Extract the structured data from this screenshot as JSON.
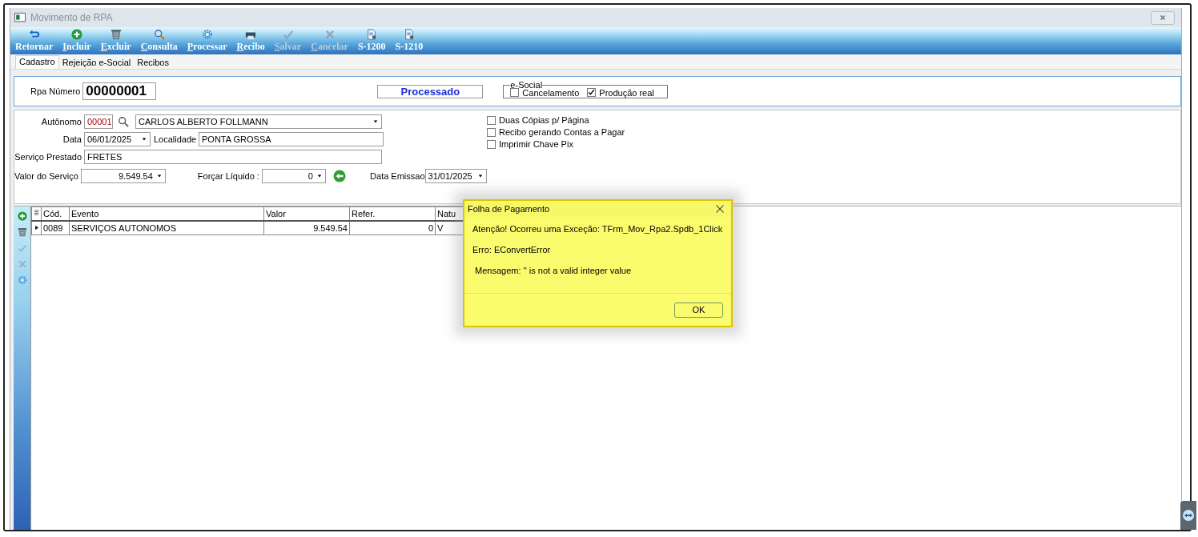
{
  "window": {
    "title": "Movimento de RPA"
  },
  "toolbar": [
    {
      "label": "Retornar",
      "kind": "return",
      "accelerator": false,
      "disabled": false
    },
    {
      "label": "Incluir",
      "kind": "add",
      "accelerator": true,
      "disabled": false
    },
    {
      "label": "Excluir",
      "kind": "trash",
      "accelerator": true,
      "disabled": false
    },
    {
      "label": "Consulta",
      "kind": "search",
      "accelerator": true,
      "disabled": false
    },
    {
      "label": "Processar",
      "kind": "gear",
      "accelerator": true,
      "disabled": false
    },
    {
      "label": "Recibo",
      "kind": "printer",
      "accelerator": true,
      "disabled": false
    },
    {
      "label": "Salvar",
      "kind": "check",
      "accelerator": true,
      "disabled": true
    },
    {
      "label": "Cancelar",
      "kind": "cross",
      "accelerator": true,
      "disabled": true
    },
    {
      "label": "S-1200",
      "kind": "doc",
      "accelerator": false,
      "disabled": false
    },
    {
      "label": "S-1210",
      "kind": "doc",
      "accelerator": false,
      "disabled": false
    }
  ],
  "tabs": [
    {
      "label": "Cadastro",
      "selected": true
    },
    {
      "label": "Rejeição e-Social",
      "selected": false
    },
    {
      "label": "Recibos",
      "selected": false
    }
  ],
  "header": {
    "rpa_label": "Rpa Número",
    "rpa_value": "00000001",
    "status": "Processado",
    "esocial": {
      "legend": "e-Social",
      "options": [
        {
          "label": "Cancelamento",
          "checked": false
        },
        {
          "label": "Produção real",
          "checked": true
        }
      ]
    }
  },
  "form": {
    "autonomo_label": "Autônomo",
    "autonomo_code": "00001",
    "autonomo_name": "CARLOS ALBERTO FOLLMANN",
    "data_label": "Data",
    "data_value": "06/01/2025",
    "localidade_label": "Localidade",
    "localidade_value": "PONTA GROSSA",
    "servico_label": "Serviço Prestado",
    "servico_value": "FRETES",
    "valor_label": "Valor do Serviço",
    "valor_value": "9.549.54",
    "forcar_label": "Forçar Líquido :",
    "forcar_value": "0",
    "emissao_label": "Data Emissao",
    "emissao_value": "31/01/2025",
    "options": [
      {
        "label": "Duas Cópias p/ Página",
        "checked": false
      },
      {
        "label": "Recibo gerando Contas a Pagar",
        "checked": false
      },
      {
        "label": "Imprimir Chave Pix",
        "checked": false
      }
    ]
  },
  "side_tools": [
    {
      "kind": "add",
      "disabled": false
    },
    {
      "kind": "trash",
      "disabled": false
    },
    {
      "kind": "check",
      "disabled": true
    },
    {
      "kind": "cross",
      "disabled": true
    },
    {
      "kind": "gear",
      "disabled": false
    }
  ],
  "table": {
    "columns": [
      "Cód.",
      "Evento",
      "Valor",
      "Refer.",
      "Natu"
    ],
    "rows": [
      {
        "selected": true,
        "cells": [
          "0089",
          "SERVIÇOS AUTONOMOS",
          "9.549.54",
          "0",
          "V"
        ]
      }
    ]
  },
  "dialog": {
    "title": "Folha de Pagamento",
    "lines": [
      "Atenção! Ocorreu uma Exceção: TFrm_Mov_Rpa2.Spdb_1Click",
      "Erro: EConvertError",
      " Mensagem: '' is not a valid integer value"
    ],
    "button": "OK"
  }
}
